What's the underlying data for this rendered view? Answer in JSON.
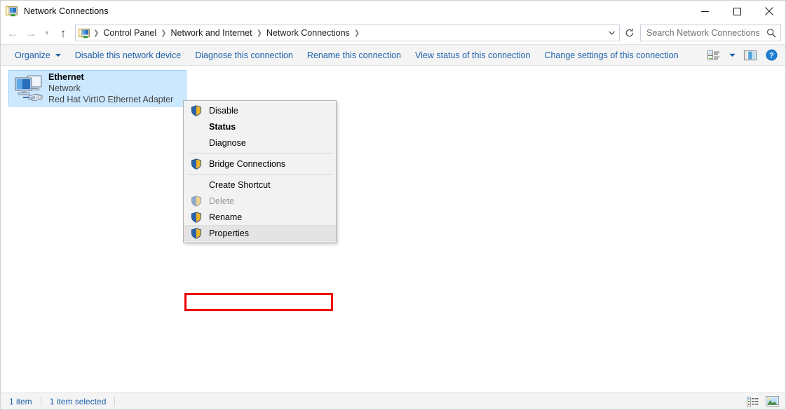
{
  "window": {
    "title": "Network Connections",
    "icon": "network-connections-icon",
    "caption_buttons": [
      {
        "name": "minimize",
        "glyph": "minimize-icon"
      },
      {
        "name": "maximize",
        "glyph": "maximize-icon"
      },
      {
        "name": "close",
        "glyph": "close-icon"
      }
    ]
  },
  "nav": {
    "back": {
      "glyph": "←",
      "enabled": false
    },
    "forward": {
      "glyph": "→",
      "enabled": false
    },
    "recent": {
      "glyph": "⌄",
      "enabled": false
    },
    "up": {
      "glyph": "↑",
      "enabled": true
    },
    "refresh_glyph": "↻"
  },
  "breadcrumb": {
    "icon": "network-connections-icon",
    "separator": "❯",
    "items": [
      "Control Panel",
      "Network and Internet",
      "Network Connections"
    ],
    "trailing_separator": "❯",
    "dropdown_glyph": "⌄"
  },
  "search": {
    "placeholder": "Search Network Connections",
    "value": "",
    "icon": "search-icon"
  },
  "toolbar": {
    "organize_label": "Organize",
    "items": [
      "Disable this network device",
      "Diagnose this connection",
      "Rename this connection",
      "View status of this connection",
      "Change settings of this connection"
    ],
    "view_options_icon": "view-options-icon",
    "view_options_caret": "▾",
    "preview_pane_icon": "preview-pane-icon",
    "help_icon": "help-icon",
    "help_glyph": "?"
  },
  "connections": [
    {
      "name": "Ethernet",
      "network": "Network",
      "adapter": "Red Hat VirtIO Ethernet Adapter",
      "icon": "network-adapter-icon",
      "selected": true
    }
  ],
  "context_menu": {
    "groups": [
      {
        "items": [
          {
            "label": "Disable",
            "icon": "shield-icon",
            "bold": false,
            "disabled": false,
            "hover": false
          },
          {
            "label": "Status",
            "icon": null,
            "bold": true,
            "disabled": false,
            "hover": false
          },
          {
            "label": "Diagnose",
            "icon": null,
            "bold": false,
            "disabled": false,
            "hover": false
          }
        ]
      },
      {
        "items": [
          {
            "label": "Bridge Connections",
            "icon": "shield-icon",
            "bold": false,
            "disabled": false,
            "hover": false
          }
        ]
      },
      {
        "items": [
          {
            "label": "Create Shortcut",
            "icon": null,
            "bold": false,
            "disabled": false,
            "hover": false
          },
          {
            "label": "Delete",
            "icon": "shield-icon",
            "bold": false,
            "disabled": true,
            "hover": false
          },
          {
            "label": "Rename",
            "icon": "shield-icon",
            "bold": false,
            "disabled": false,
            "hover": false
          },
          {
            "label": "Properties",
            "icon": "shield-icon",
            "bold": false,
            "disabled": false,
            "hover": true
          }
        ]
      }
    ]
  },
  "annotation": {
    "target": "Properties",
    "color": "#ee0000"
  },
  "statusbar": {
    "item_count": "1 item",
    "selection": "1 item selected",
    "details_view_icon": "details-view-icon",
    "large_icons_view_icon": "large-icons-view-icon"
  },
  "colors": {
    "accent_link": "#1b5faa",
    "selection_fill": "#cce8ff",
    "selection_border": "#99d1ff",
    "chrome": "#f4f4f4",
    "menu_bg": "#f2f2f2",
    "annotation_red": "#ee0000"
  }
}
